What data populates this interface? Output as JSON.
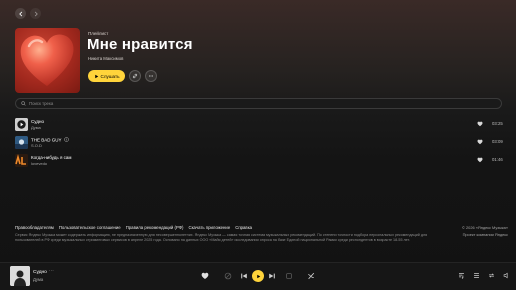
{
  "playlist": {
    "type_label": "Плейлист",
    "title": "Мне нравится",
    "author": "Никита Максимов",
    "play_label": "Слушать"
  },
  "search": {
    "placeholder": "Поиск трека"
  },
  "tracks": [
    {
      "title": "Судно",
      "artist": "Дума",
      "duration": "03:25"
    },
    {
      "title": "THE BAD GUY",
      "artist": "S.O.D",
      "duration": "03:09"
    },
    {
      "title": "Когда-нибудь я сам",
      "artist": "lovevedo",
      "duration": "01:46"
    }
  ],
  "footer": {
    "links": [
      "Правообладателям",
      "Пользовательское соглашение",
      "Правила рекомендаций (РФ)",
      "Скачать приложение",
      "Справка"
    ],
    "text": "Сервис Яндекс Музыка может содержать информацию, не предназначенную для несовершеннолетних. Яндекс Музыка — самая точная система музыкальных рекомендаций. По степени точности подбора персональных рекомендаций для пользователей в РФ среди музыкальных стриминговых сервисов в апреле 2025 года. Основано на данных ООО «Майя детей» исследовании опроса на базе Единой национальной Рамки среди респондентов в возрасте 18-55 лет.",
    "copyright_line1": "© 2026 «Яндекс Музыка»",
    "copyright_line2": "Проект компании Яндекс"
  },
  "player": {
    "title": "Судно",
    "more": "···",
    "artist": "Дума"
  },
  "colors": {
    "accent": "#ffd43b",
    "background": "#131313"
  }
}
